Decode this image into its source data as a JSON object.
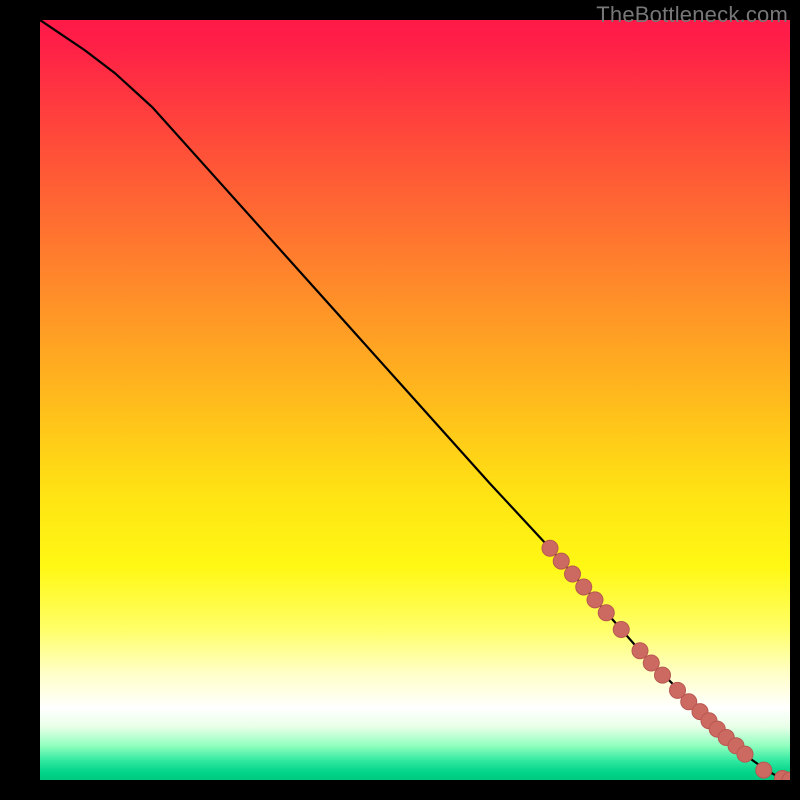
{
  "watermark": "TheBottleneck.com",
  "colors": {
    "background": "#000000",
    "gradient_stops": [
      {
        "offset": 0.0,
        "color": "#ff1a48"
      },
      {
        "offset": 0.03,
        "color": "#ff1f47"
      },
      {
        "offset": 0.18,
        "color": "#ff5238"
      },
      {
        "offset": 0.35,
        "color": "#ff8a2a"
      },
      {
        "offset": 0.5,
        "color": "#ffbb1c"
      },
      {
        "offset": 0.63,
        "color": "#ffe513"
      },
      {
        "offset": 0.72,
        "color": "#fff814"
      },
      {
        "offset": 0.8,
        "color": "#ffff66"
      },
      {
        "offset": 0.86,
        "color": "#ffffc8"
      },
      {
        "offset": 0.905,
        "color": "#ffffff"
      },
      {
        "offset": 0.93,
        "color": "#e8ffe8"
      },
      {
        "offset": 0.955,
        "color": "#90ffbe"
      },
      {
        "offset": 0.975,
        "color": "#30e8a0"
      },
      {
        "offset": 0.99,
        "color": "#00d488"
      },
      {
        "offset": 1.0,
        "color": "#00c97f"
      }
    ],
    "curve": "#000000",
    "point_fill": "#cc6a62",
    "point_stroke": "#b85750"
  },
  "chart_data": {
    "type": "line",
    "title": "",
    "xlabel": "",
    "ylabel": "",
    "xlim": [
      0,
      100
    ],
    "ylim": [
      0,
      100
    ],
    "series": [
      {
        "name": "curve",
        "x": [
          0,
          3,
          6,
          10,
          15,
          20,
          30,
          40,
          50,
          60,
          68,
          72,
          76,
          80,
          84,
          88,
          91,
          93,
          95,
          97,
          98.5,
          100
        ],
        "y": [
          100,
          98,
          96,
          93,
          88.5,
          83,
          72,
          61,
          50,
          39,
          30.5,
          26,
          21.5,
          17,
          13,
          9,
          6,
          4.2,
          2.6,
          1.2,
          0.4,
          0
        ]
      }
    ],
    "points": {
      "name": "highlighted-points",
      "x": [
        68,
        69.5,
        71,
        72.5,
        74,
        75.5,
        77.5,
        80,
        81.5,
        83,
        85,
        86.5,
        88,
        89.2,
        90.3,
        91.5,
        92.8,
        94,
        96.5,
        99,
        100
      ],
      "y": [
        30.5,
        28.8,
        27.1,
        25.4,
        23.7,
        22.0,
        19.8,
        17.0,
        15.4,
        13.8,
        11.8,
        10.3,
        9.0,
        7.8,
        6.7,
        5.6,
        4.5,
        3.4,
        1.3,
        0.2,
        0
      ]
    }
  }
}
